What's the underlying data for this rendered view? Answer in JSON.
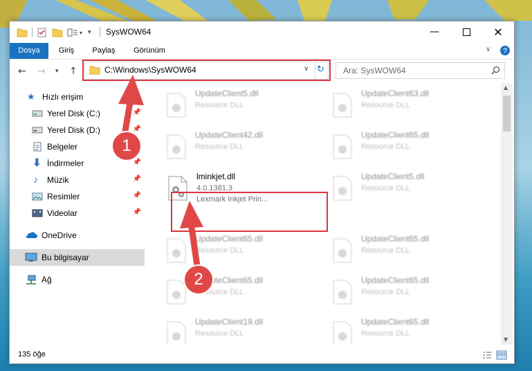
{
  "window": {
    "title": "SysWOW64"
  },
  "ribbon": {
    "tabs": [
      "Dosya",
      "Giriş",
      "Paylaş",
      "Görünüm"
    ]
  },
  "nav": {
    "address": "C:\\Windows\\SysWOW64",
    "search_placeholder": "Ara: SysWOW64"
  },
  "sidebar": {
    "items": [
      {
        "label": "Hızlı erişim",
        "icon": "star-icon"
      },
      {
        "label": "Yerel Disk (C:)",
        "icon": "drive-icon"
      },
      {
        "label": "Yerel Disk (D:)",
        "icon": "drive-icon"
      },
      {
        "label": "Belgeler",
        "icon": "documents-icon"
      },
      {
        "label": "İndirmeler",
        "icon": "download-icon"
      },
      {
        "label": "Müzik",
        "icon": "music-icon"
      },
      {
        "label": "Resimler",
        "icon": "pictures-icon"
      },
      {
        "label": "Videolar",
        "icon": "videos-icon"
      },
      {
        "label": "OneDrive",
        "icon": "cloud-icon"
      },
      {
        "label": "Bu bilgisayar",
        "icon": "computer-icon"
      },
      {
        "label": "Ağ",
        "icon": "network-icon"
      }
    ]
  },
  "files": {
    "left": [
      {
        "name": "UpdateClient5.dll",
        "desc": "Resource DLL"
      },
      {
        "name": "UpdateClient42.dll",
        "desc": "Resource DLL"
      },
      {
        "name": "lminkjet.dll",
        "version": "4.0.1381.3",
        "desc": "Lexmark Inkjet Prin..."
      },
      {
        "name": "UpdateClient65.dll",
        "desc": "Resource DLL"
      },
      {
        "name": "UpdateClient65.dll",
        "desc": "Resource DLL"
      },
      {
        "name": "UpdateClient19.dll",
        "desc": "Resource DLL"
      }
    ],
    "right": [
      {
        "name": "UpdateClient63.dll",
        "desc": "Resource DLL"
      },
      {
        "name": "UpdateClient65.dll",
        "desc": "Resource DLL"
      },
      {
        "name": "UpdateClient5.dll",
        "desc": "Resource DLL"
      },
      {
        "name": "UpdateClient65.dll",
        "desc": "Resource DLL"
      },
      {
        "name": "UpdateClient65.dll",
        "desc": "Resource DLL"
      },
      {
        "name": "UpdateClient65.dll",
        "desc": "Resource DLL"
      }
    ]
  },
  "status": {
    "count": "135 öğe"
  },
  "annotations": {
    "step1": "1",
    "step2": "2"
  },
  "colors": {
    "accent": "#1a73c0",
    "highlight": "#d9363e"
  }
}
